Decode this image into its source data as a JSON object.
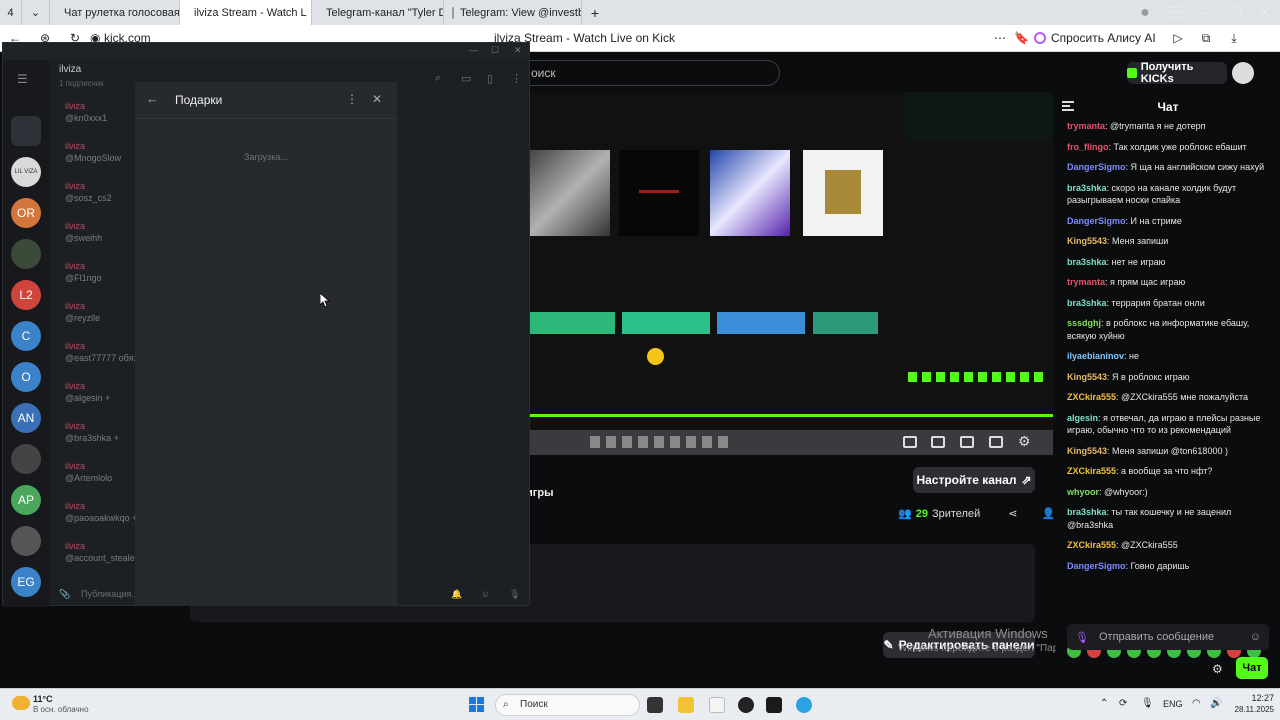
{
  "browser": {
    "tab_count": "4",
    "tabs": [
      {
        "label": "Чат рулетка голосовая –",
        "icon_color": "#3aa0e8"
      },
      {
        "label": "ilviza Stream - Watch L",
        "icon_color": "#53fc18"
      },
      {
        "label": "Telegram-канал \"Tyler Du",
        "icon_color": "#3aa0e8"
      },
      {
        "label": "Telegram: View @investb",
        "icon_color": "#dddddd"
      }
    ],
    "url": "kick.com",
    "page_title": "ilviza Stream - Watch Live on Kick",
    "alice_button": "Спросить Алису AI"
  },
  "kick": {
    "search_placeholder": "оиск",
    "get_kicks": "Получить KICKs",
    "stream_title": "игры",
    "setup_channel": "Настройте канал",
    "viewers_count": "29",
    "viewers_label": "Зрителей",
    "edit_panels": "Редактировать панели",
    "watermark_title": "Активация Windows",
    "watermark_sub": "Чтобы активировать Windows, перейдите в раздел \"Параметры\".",
    "watermark_sub_visible": "Windows перейдите в раздел \"Параметры\"."
  },
  "chat": {
    "title": "Чат",
    "input_placeholder": "Отправить сообщение",
    "send_label": "Чат",
    "messages": [
      {
        "user": "trymanta",
        "color": "#e5536b",
        "text": "@trymanta я не дотерп"
      },
      {
        "user": "fro_flingo",
        "color": "#e5536b",
        "text": "Так холдик уже роблокс ебашит"
      },
      {
        "user": "DangerSigmo",
        "color": "#7b8cff",
        "text": "Я ща на английском сижу нахуй"
      },
      {
        "user": "bra3shka",
        "color": "#7fe0c5",
        "text": "скоро на канале холдик будут разыгрываем носки спайка"
      },
      {
        "user": "DangerSigmo",
        "color": "#7b8cff",
        "text": "И на стриме"
      },
      {
        "user": "King5543",
        "color": "#e8b86a",
        "text": "Меня запиши"
      },
      {
        "user": "bra3shka",
        "color": "#7fe0c5",
        "text": "нет не играю"
      },
      {
        "user": "trymanta",
        "color": "#e5536b",
        "text": "я прям щас играю"
      },
      {
        "user": "bra3shka",
        "color": "#7fe0c5",
        "text": "террария братан онли"
      },
      {
        "user": "sssdghj",
        "color": "#7fe05a",
        "text": "в роблокс на информатике ебашу, всякую хуйню"
      },
      {
        "user": "ilyaebianinov",
        "color": "#7fc7ff",
        "text": "не"
      },
      {
        "user": "King5543",
        "color": "#e8b86a",
        "text": "Я в роблокс играю"
      },
      {
        "user": "ZXCkira555",
        "color": "#f0c040",
        "text": "@ZXCkira555 мне пожалуйста"
      },
      {
        "user": "algesin",
        "color": "#7fe0c5",
        "text": "я отвечал, да играю в плейсы разные играю, обычно что то из рекомендаций"
      },
      {
        "user": "King5543",
        "color": "#e8b86a",
        "text": "Меня запиши @ton618000 )"
      },
      {
        "user": "ZXCkira555",
        "color": "#f0c040",
        "text": "а вообще за что нфт?"
      },
      {
        "user": "whyoor",
        "color": "#7fe05a",
        "text": "@whyoor:)"
      },
      {
        "user": "bra3shka",
        "color": "#7fe0c5",
        "text": "ты так кошечку и не заценил @bra3shka"
      },
      {
        "user": "ZXCkira555",
        "color": "#f0c040",
        "text": "@ZXCkira555"
      },
      {
        "user": "DangerSigmo",
        "color": "#7b8cff",
        "text": "Говно даришь"
      }
    ]
  },
  "telegram": {
    "channel_name": "ilviza",
    "channel_sub": "1 подписчик",
    "gifts_title": "Подарки",
    "loading": "Загрузка...",
    "bottom_placeholder": "Публикация...",
    "subscribers": [
      {
        "name": "ilviza",
        "handle": "@kn0xxx1"
      },
      {
        "name": "ilviza",
        "handle": "@MnogoSlow"
      },
      {
        "name": "ilviza",
        "handle": "@sosz_cs2"
      },
      {
        "name": "ilviza",
        "handle": "@sweihh"
      },
      {
        "name": "ilviza",
        "handle": "@Fl1ngo"
      },
      {
        "name": "ilviza",
        "handle": "@reyzlle"
      },
      {
        "name": "ilviza",
        "handle": "@east77777 обяза"
      },
      {
        "name": "ilviza",
        "handle": "@algesin +"
      },
      {
        "name": "ilviza",
        "handle": "@bra3shka +"
      },
      {
        "name": "ilviza",
        "handle": "@Artemlolo"
      },
      {
        "name": "ilviza",
        "handle": "@paoaoakwkqo +"
      },
      {
        "name": "ilviza",
        "handle": "@account_stealer"
      }
    ],
    "sidebar_avatars": [
      {
        "label": "",
        "color": "#2e3137"
      },
      {
        "label": "LIL VIZA",
        "color": "#d9d9d9"
      },
      {
        "label": "OR",
        "color": "#d4763b"
      },
      {
        "label": "",
        "color": "#3c4a3a"
      },
      {
        "label": "L2",
        "color": "#d0453b"
      },
      {
        "label": "C",
        "color": "#3b82c9"
      },
      {
        "label": "O",
        "color": "#3b82c9"
      },
      {
        "label": "AN",
        "color": "#3b6fb8"
      },
      {
        "label": "",
        "color": "#444"
      },
      {
        "label": "AP",
        "color": "#4aa65a"
      },
      {
        "label": "",
        "color": "#555"
      },
      {
        "label": "EG",
        "color": "#3b82c9"
      }
    ]
  },
  "taskbar": {
    "weather_temp": "11°C",
    "weather_desc": "В осн. облачно",
    "search_label": "Поиск",
    "lang": "ENG",
    "time": "12:27",
    "date": "28.11.2025"
  }
}
